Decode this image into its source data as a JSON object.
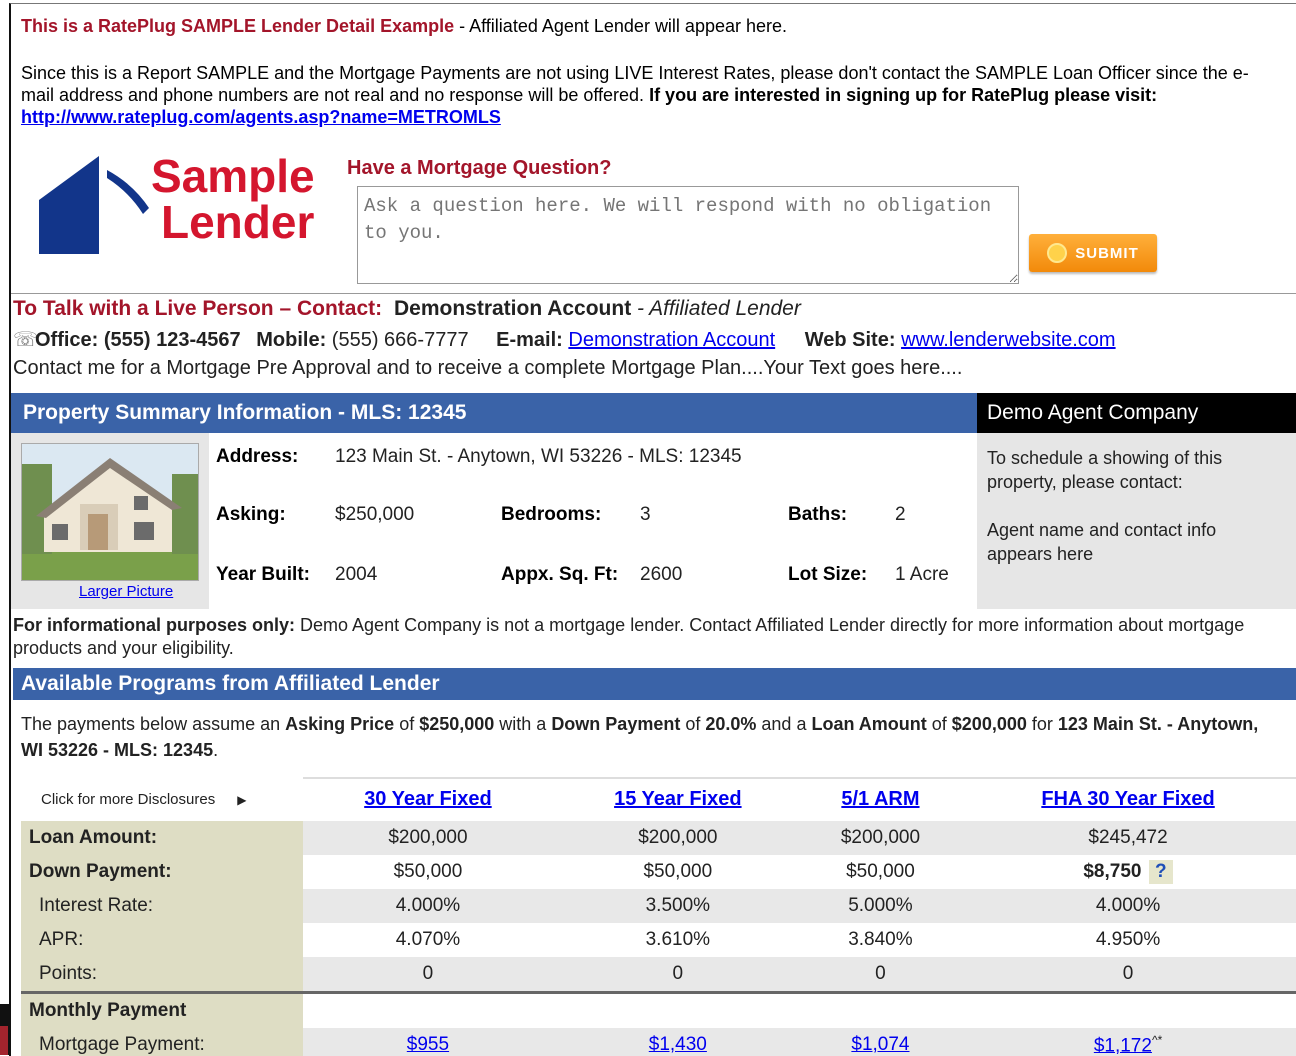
{
  "notice": {
    "title": "This is a RatePlug SAMPLE Lender Detail Example",
    "title_suffix": " - Affiliated Agent Lender will appear here.",
    "body": "Since this is a Report SAMPLE and the Mortgage Payments are not using LIVE Interest Rates, please don't contact the SAMPLE Loan Officer since the e-mail address and phone numbers are not real and no response will be offered. ",
    "signup_bold": "If you are interested in signing up for RatePlug please visit: ",
    "signup_link": "http://www.rateplug.com/agents.asp?name=METROMLS"
  },
  "logo": {
    "line1": "Sample",
    "line2": "Lender"
  },
  "question": {
    "heading": "Have a Mortgage Question?",
    "placeholder": "Ask a question here. We will respond with no obligation to you.",
    "submit_label": "SUBMIT"
  },
  "contact": {
    "heading": "To Talk with a Live Person – Contact:",
    "name": "Demonstration Account",
    "role": " - Affiliated Lender",
    "office_label": "Office: (555) 123-4567",
    "mobile_label": "Mobile:",
    "mobile_value": "(555) 666-7777",
    "email_label": "E-mail:",
    "email_link": "Demonstration Account",
    "web_label": "Web Site:",
    "web_link": "www.lenderwebsite.com",
    "blurb": "Contact me for a Mortgage Pre Approval and to receive a complete Mortgage Plan....Your Text goes here...."
  },
  "property": {
    "header": "Property Summary Information - MLS: 12345",
    "larger_picture": "Larger Picture",
    "address_label": "Address:",
    "address_value": "123 Main St. - Anytown, WI 53226 - MLS: 12345",
    "asking_label": "Asking:",
    "asking_value": "$250,000",
    "bedrooms_label": "Bedrooms:",
    "bedrooms_value": "3",
    "baths_label": "Baths:",
    "baths_value": "2",
    "year_label": "Year Built:",
    "year_value": "2004",
    "sqft_label": "Appx. Sq. Ft:",
    "sqft_value": "2600",
    "lot_label": "Lot Size:",
    "lot_value": "1 Acre"
  },
  "agent": {
    "company": "Demo Agent Company",
    "schedule": "To schedule a showing of this property, please contact:",
    "info": "Agent name and contact info appears here"
  },
  "disclaimer": {
    "bold": "For informational purposes only:",
    "text": " Demo Agent Company is not a mortgage lender. Contact Affiliated Lender directly for more information about mortgage products and your eligibility."
  },
  "programs": {
    "header": "Available Programs from Affiliated Lender",
    "intro": [
      {
        "t": "The payments below assume an ",
        "b": false
      },
      {
        "t": "Asking Price",
        "b": true
      },
      {
        "t": " of ",
        "b": false
      },
      {
        "t": "$250,000",
        "b": true
      },
      {
        "t": " with a ",
        "b": false
      },
      {
        "t": "Down Payment",
        "b": true
      },
      {
        "t": " of ",
        "b": false
      },
      {
        "t": "20.0%",
        "b": true
      },
      {
        "t": " and a ",
        "b": false
      },
      {
        "t": "Loan Amount",
        "b": true
      },
      {
        "t": " of ",
        "b": false
      },
      {
        "t": "$200,000",
        "b": true
      },
      {
        "t": " for ",
        "b": false
      },
      {
        "t": "123 Main St. - Anytown, WI 53226 - MLS: 12345",
        "b": true
      },
      {
        "t": ".",
        "b": false
      }
    ],
    "disclosures_label": "Click for more Disclosures",
    "columns": [
      "30 Year Fixed",
      "15 Year Fixed",
      "5/1 ARM",
      "FHA 30 Year Fixed"
    ],
    "rows": [
      {
        "label": "Loan Amount:",
        "bold": true,
        "values": [
          "$200,000",
          "$200,000",
          "$200,000",
          "$245,472"
        ]
      },
      {
        "label": "Down Payment:",
        "bold": true,
        "values": [
          "$50,000",
          "$50,000",
          "$50,000",
          "$8,750"
        ]
      },
      {
        "label": "Interest Rate:",
        "bold": false,
        "values": [
          "4.000%",
          "3.500%",
          "5.000%",
          "4.000%"
        ]
      },
      {
        "label": "APR:",
        "bold": false,
        "values": [
          "4.070%",
          "3.610%",
          "3.840%",
          "4.950%"
        ]
      },
      {
        "label": "Points:",
        "bold": false,
        "values": [
          "0",
          "0",
          "0",
          "0"
        ]
      }
    ],
    "fha_help": "?",
    "monthly_header": "Monthly Payment",
    "mortgage_label": "Mortgage Payment:",
    "mortgage_values": [
      "$955",
      "$1,430",
      "$1,074",
      "$1,172"
    ],
    "mortgage_fha_suffix": "^*"
  }
}
